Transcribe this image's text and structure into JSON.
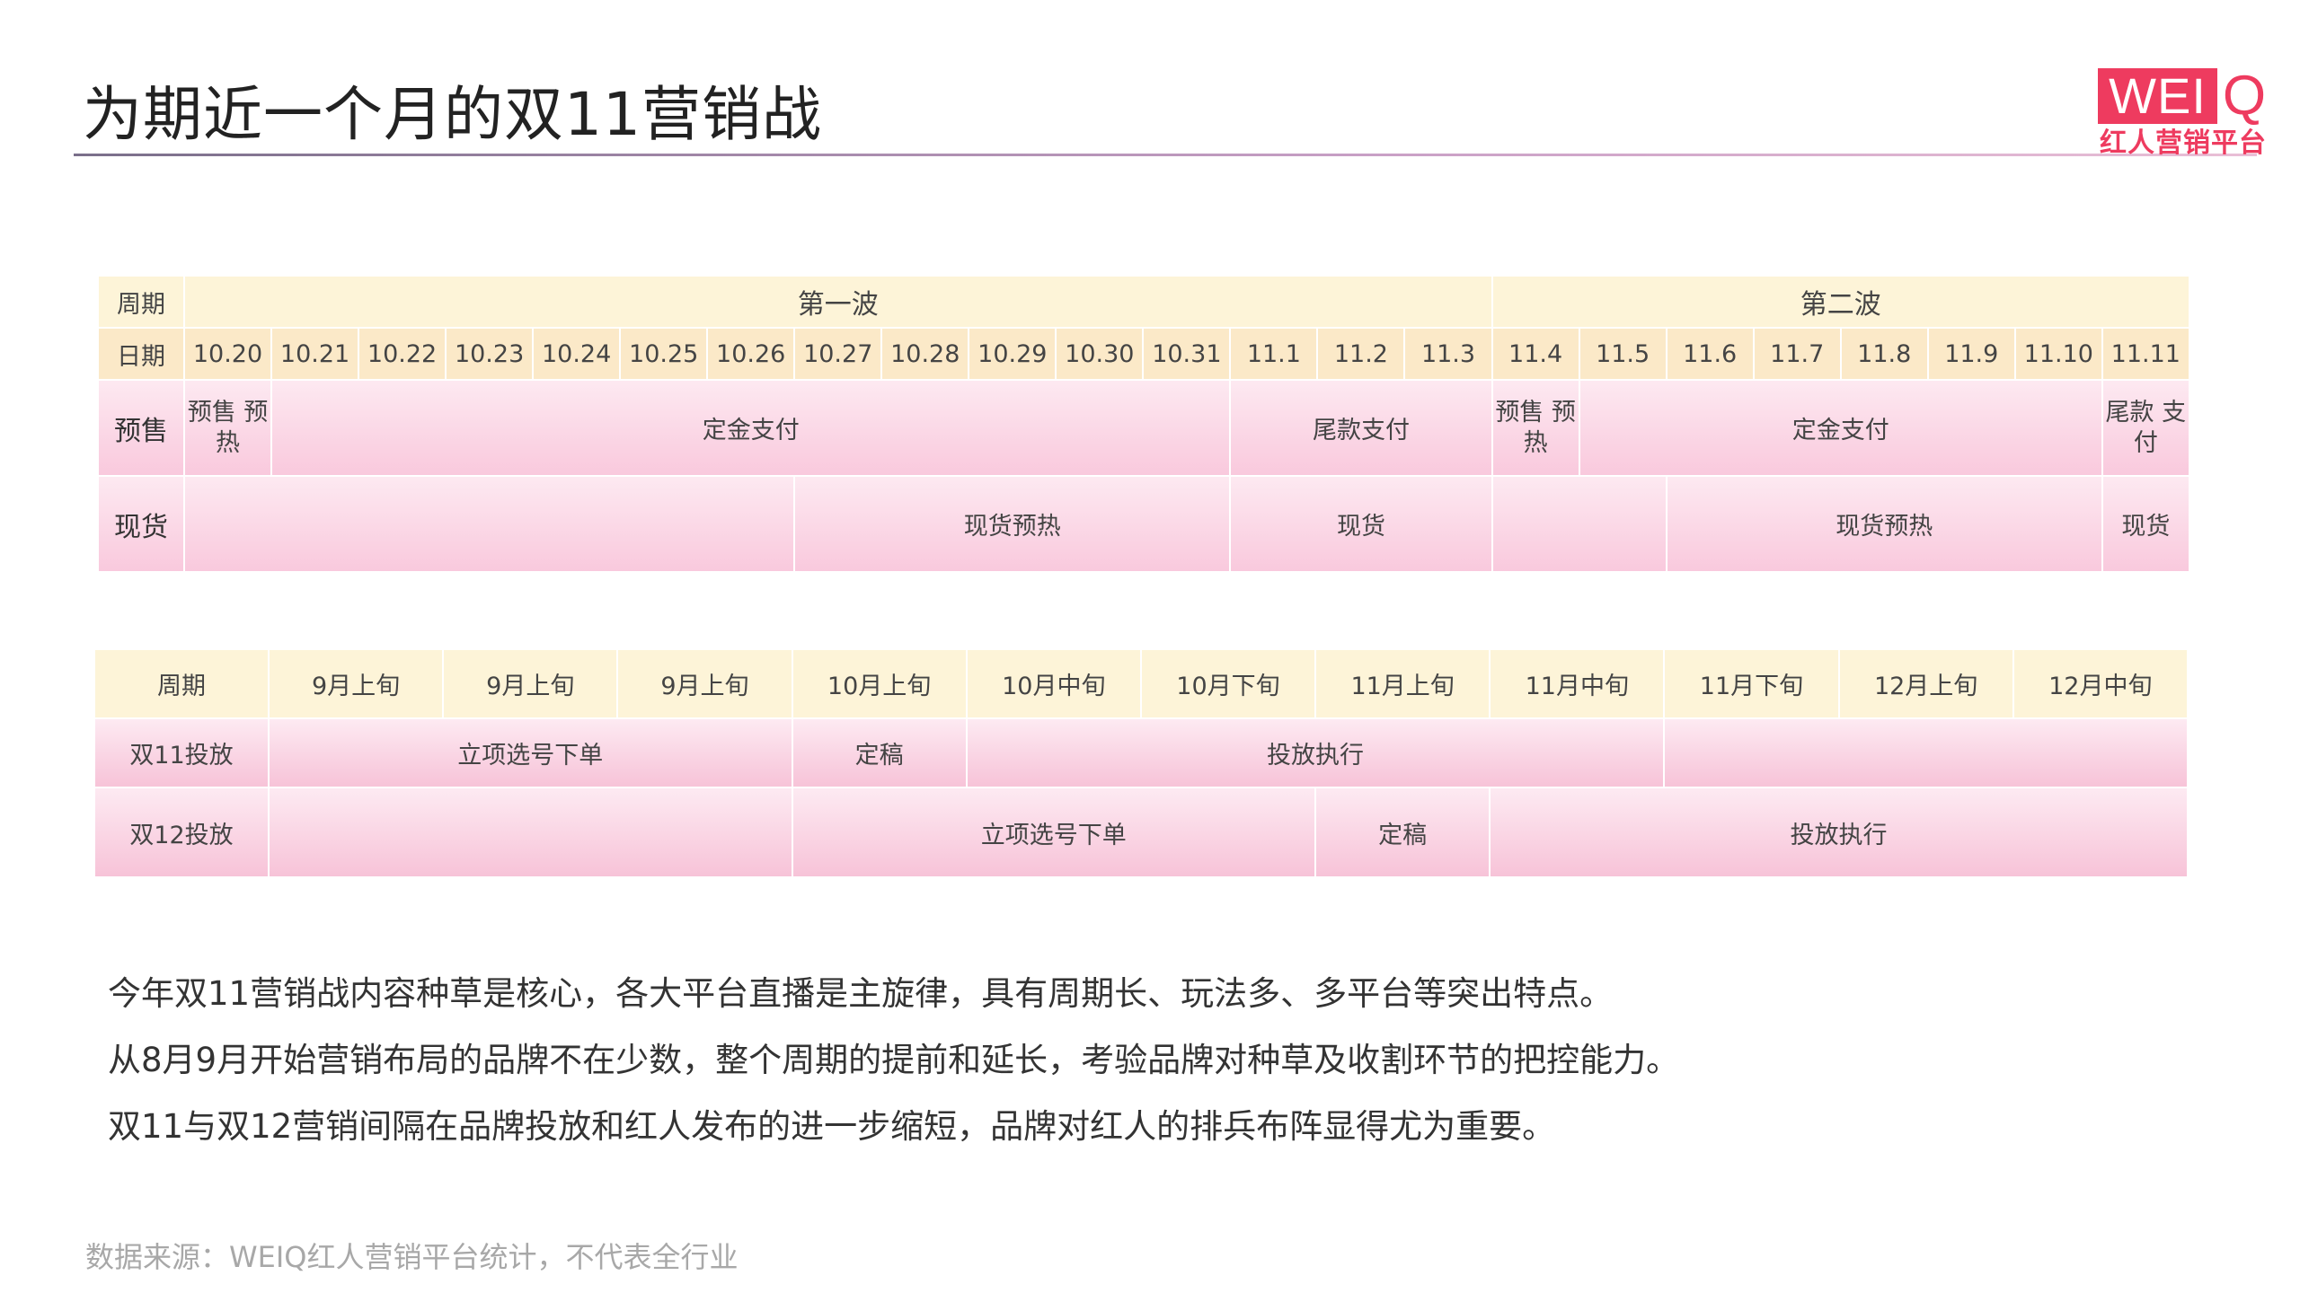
{
  "title": "为期近一个月的双11营销战",
  "logo": {
    "brand": "WEI",
    "brand_q": "Q",
    "sub": "红人营销平台"
  },
  "table1": {
    "period_label": "周期",
    "date_label": "日期",
    "waves": [
      "第一波",
      "第二波"
    ],
    "dates": [
      "10.20",
      "10.21",
      "10.22",
      "10.23",
      "10.24",
      "10.25",
      "10.26",
      "10.27",
      "10.28",
      "10.29",
      "10.30",
      "10.31",
      "11.1",
      "11.2",
      "11.3",
      "11.4",
      "11.5",
      "11.6",
      "11.7",
      "11.8",
      "11.9",
      "11.10",
      "11.11"
    ],
    "presale": {
      "label": "预售",
      "wave1_preheat": "预售\n预热",
      "wave1_deposit": "定金支付",
      "wave1_final": "尾款支付",
      "wave2_preheat": "预售\n预热",
      "wave2_deposit": "定金支付",
      "wave2_final": "尾款\n支付"
    },
    "spot": {
      "label": "现货",
      "wave1_preheat": "现货预热",
      "wave1_spot": "现货",
      "wave2_preheat": "现货预热",
      "wave2_spot": "现货"
    }
  },
  "table2": {
    "period_label": "周期",
    "periods": [
      "9月上旬",
      "9月上旬",
      "9月上旬",
      "10月上旬",
      "10月中旬",
      "10月下旬",
      "11月上旬",
      "11月中旬",
      "11月下旬",
      "12月上旬",
      "12月中旬"
    ],
    "d11": {
      "label": "双11投放",
      "plan": "立项选号下单",
      "final": "定稿",
      "exec": "投放执行"
    },
    "d12": {
      "label": "双12投放",
      "plan": "立项选号下单",
      "final": "定稿",
      "exec": "投放执行"
    }
  },
  "notes": [
    "今年双11营销战内容种草是核心，各大平台直播是主旋律，具有周期长、玩法多、多平台等突出特点。",
    "从8月9月开始营销布局的品牌不在少数，整个周期的提前和延长，考验品牌对种草及收割环节的把控能力。",
    "双11与双12营销间隔在品牌投放和红人发布的进一步缩短，品牌对红人的排兵布阵显得尤为重要。"
  ],
  "source": "数据来源：WEIQ红人营销平台统计，不代表全行业",
  "colors": {
    "accent": "#ee3b5f",
    "header_yellow": "#fdf4d8",
    "row_pink": "#f9c9dd"
  }
}
